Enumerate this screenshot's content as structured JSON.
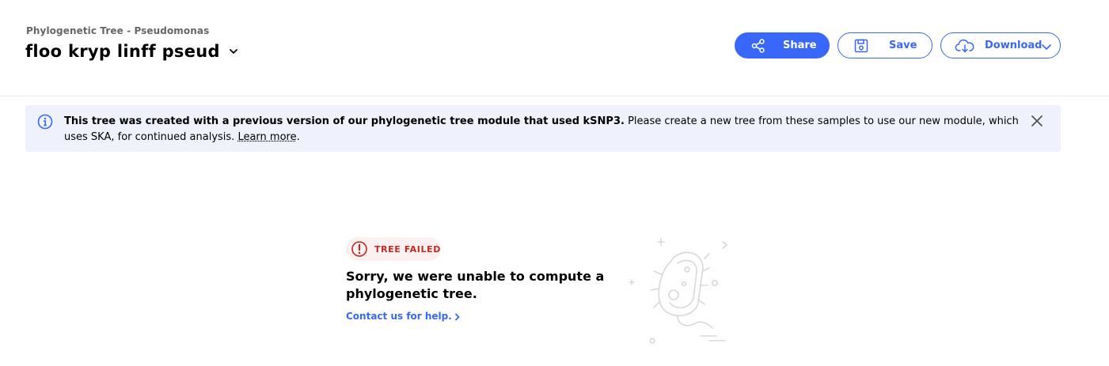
{
  "header": {
    "subtitle": "Phylogenetic Tree - Pseudomonas",
    "title": "floo kryp linff pseud",
    "title_dropdown_icon": "chevron-down-icon"
  },
  "toolbar": {
    "share_label": "Share",
    "share_icon": "share-icon",
    "save_label": "Save",
    "save_icon": "floppy-disk-icon",
    "download_label": "Download",
    "download_icon": "cloud-download-icon"
  },
  "banner": {
    "bold_text": "This tree was created with a previous version of our phylogenetic tree module that used kSNP3.",
    "text": " Please create a new tree from these samples to use our new module, which uses SKA, for continued analysis. ",
    "link_text": "Learn more",
    "trailing": ".",
    "icon": "info-icon",
    "close_icon": "close-icon"
  },
  "error": {
    "status_label": "TREE FAILED",
    "status_icon": "alert-circle-icon",
    "message": "Sorry, we were unable to compute a phylogenetic tree.",
    "contact_text": "Contact us for help.",
    "illustration": "bacterium-illustration"
  },
  "colors": {
    "primary": "#3867fa",
    "banner_bg": "#eff2fc",
    "error": "#c4271f",
    "error_bg": "#fdf0f0"
  }
}
